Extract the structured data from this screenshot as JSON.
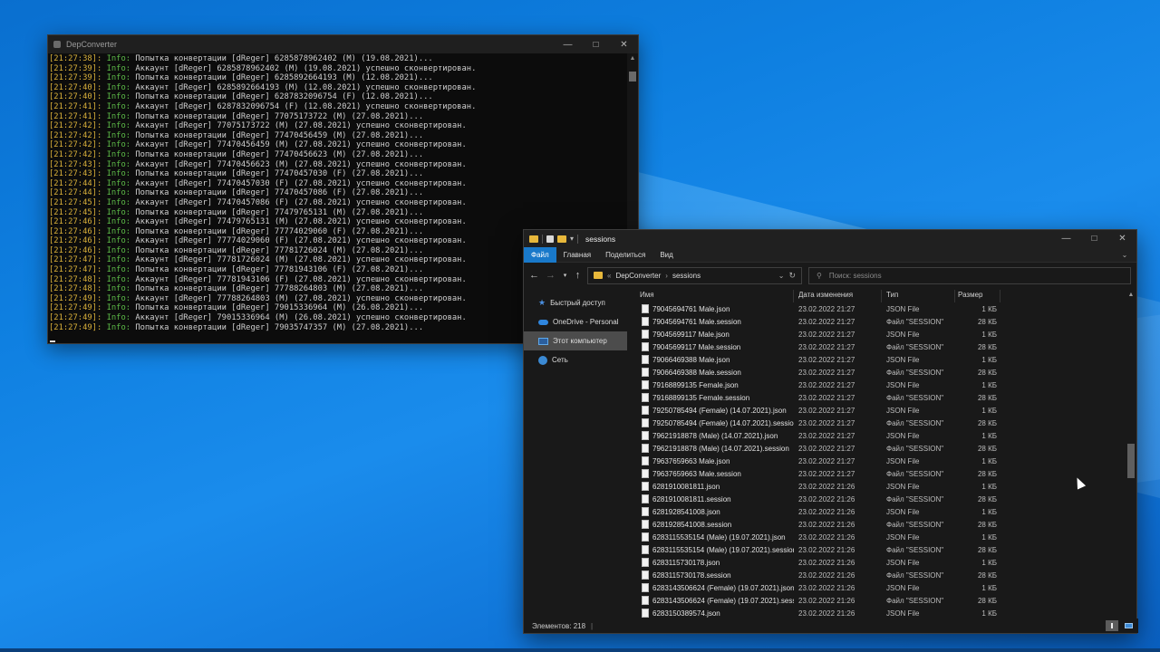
{
  "console": {
    "title": "DepConverter",
    "lines": [
      {
        "ts": "[21:27:38]:",
        "lvl": "Info:",
        "msg": "Попытка конвертации [dReger] 6285878962402 (M) (19.08.2021)..."
      },
      {
        "ts": "[21:27:39]:",
        "lvl": "Info:",
        "msg": "Аккаунт [dReger] 6285878962402 (M) (19.08.2021) успешно сконвертирован."
      },
      {
        "ts": "[21:27:39]:",
        "lvl": "Info:",
        "msg": "Попытка конвертации [dReger] 6285892664193 (M) (12.08.2021)..."
      },
      {
        "ts": "[21:27:40]:",
        "lvl": "Info:",
        "msg": "Аккаунт [dReger] 6285892664193 (M) (12.08.2021) успешно сконвертирован."
      },
      {
        "ts": "[21:27:40]:",
        "lvl": "Info:",
        "msg": "Попытка конвертации [dReger] 6287832096754 (F) (12.08.2021)..."
      },
      {
        "ts": "[21:27:41]:",
        "lvl": "Info:",
        "msg": "Аккаунт [dReger] 6287832096754 (F) (12.08.2021) успешно сконвертирован."
      },
      {
        "ts": "[21:27:41]:",
        "lvl": "Info:",
        "msg": "Попытка конвертации [dReger] 77075173722 (M) (27.08.2021)..."
      },
      {
        "ts": "[21:27:42]:",
        "lvl": "Info:",
        "msg": "Аккаунт [dReger] 77075173722 (M) (27.08.2021) успешно сконвертирован."
      },
      {
        "ts": "[21:27:42]:",
        "lvl": "Info:",
        "msg": "Попытка конвертации [dReger] 77470456459 (M) (27.08.2021)..."
      },
      {
        "ts": "[21:27:42]:",
        "lvl": "Info:",
        "msg": "Аккаунт [dReger] 77470456459 (M) (27.08.2021) успешно сконвертирован."
      },
      {
        "ts": "[21:27:42]:",
        "lvl": "Info:",
        "msg": "Попытка конвертации [dReger] 77470456623 (M) (27.08.2021)..."
      },
      {
        "ts": "[21:27:43]:",
        "lvl": "Info:",
        "msg": "Аккаунт [dReger] 77470456623 (M) (27.08.2021) успешно сконвертирован."
      },
      {
        "ts": "[21:27:43]:",
        "lvl": "Info:",
        "msg": "Попытка конвертации [dReger] 77470457030 (F) (27.08.2021)..."
      },
      {
        "ts": "[21:27:44]:",
        "lvl": "Info:",
        "msg": "Аккаунт [dReger] 77470457030 (F) (27.08.2021) успешно сконвертирован."
      },
      {
        "ts": "[21:27:44]:",
        "lvl": "Info:",
        "msg": "Попытка конвертации [dReger] 77470457086 (F) (27.08.2021)..."
      },
      {
        "ts": "[21:27:45]:",
        "lvl": "Info:",
        "msg": "Аккаунт [dReger] 77470457086 (F) (27.08.2021) успешно сконвертирован."
      },
      {
        "ts": "[21:27:45]:",
        "lvl": "Info:",
        "msg": "Попытка конвертации [dReger] 77479765131 (M) (27.08.2021)..."
      },
      {
        "ts": "[21:27:46]:",
        "lvl": "Info:",
        "msg": "Аккаунт [dReger] 77479765131 (M) (27.08.2021) успешно сконвертирован."
      },
      {
        "ts": "[21:27:46]:",
        "lvl": "Info:",
        "msg": "Попытка конвертации [dReger] 77774029060 (F) (27.08.2021)..."
      },
      {
        "ts": "[21:27:46]:",
        "lvl": "Info:",
        "msg": "Аккаунт [dReger] 77774029060 (F) (27.08.2021) успешно сконвертирован."
      },
      {
        "ts": "[21:27:46]:",
        "lvl": "Info:",
        "msg": "Попытка конвертации [dReger] 77781726024 (M) (27.08.2021)..."
      },
      {
        "ts": "[21:27:47]:",
        "lvl": "Info:",
        "msg": "Аккаунт [dReger] 77781726024 (M) (27.08.2021) успешно сконвертирован."
      },
      {
        "ts": "[21:27:47]:",
        "lvl": "Info:",
        "msg": "Попытка конвертации [dReger] 77781943106 (F) (27.08.2021)..."
      },
      {
        "ts": "[21:27:48]:",
        "lvl": "Info:",
        "msg": "Аккаунт [dReger] 77781943106 (F) (27.08.2021) успешно сконвертирован."
      },
      {
        "ts": "[21:27:48]:",
        "lvl": "Info:",
        "msg": "Попытка конвертации [dReger] 77788264803 (M) (27.08.2021)..."
      },
      {
        "ts": "[21:27:49]:",
        "lvl": "Info:",
        "msg": "Аккаунт [dReger] 77788264803 (M) (27.08.2021) успешно сконвертирован."
      },
      {
        "ts": "[21:27:49]:",
        "lvl": "Info:",
        "msg": "Попытка конвертации [dReger] 79015336964 (M) (26.08.2021)..."
      },
      {
        "ts": "[21:27:49]:",
        "lvl": "Info:",
        "msg": "Аккаунт [dReger] 79015336964 (M) (26.08.2021) успешно сконвертирован."
      },
      {
        "ts": "[21:27:49]:",
        "lvl": "Info:",
        "msg": "Попытка конвертации [dReger] 79035747357 (M) (27.08.2021)..."
      }
    ]
  },
  "explorer": {
    "title": "sessions",
    "ribbon_tabs": [
      "Файл",
      "Главная",
      "Поделиться",
      "Вид"
    ],
    "address": {
      "separator": "«",
      "parent": "DepConverter",
      "arrow": "›",
      "current": "sessions"
    },
    "search_placeholder": "Поиск: sessions",
    "nav_items": [
      {
        "label": "Быстрый доступ",
        "icon": "star-icon",
        "selected": false
      },
      {
        "label": "OneDrive - Personal",
        "icon": "cloud-icon",
        "selected": false
      },
      {
        "label": "Этот компьютер",
        "icon": "computer-icon",
        "selected": true
      },
      {
        "label": "Сеть",
        "icon": "network-icon",
        "selected": false
      }
    ],
    "columns": {
      "name": "Имя",
      "date": "Дата изменения",
      "type": "Тип",
      "size": "Размер"
    },
    "files": [
      {
        "name": "79045694761 Male.json",
        "date": "23.02.2022 21:27",
        "type": "JSON File",
        "size": "1 КБ"
      },
      {
        "name": "79045694761 Male.session",
        "date": "23.02.2022 21:27",
        "type": "Файл \"SESSION\"",
        "size": "28 КБ"
      },
      {
        "name": "79045699117 Male.json",
        "date": "23.02.2022 21:27",
        "type": "JSON File",
        "size": "1 КБ"
      },
      {
        "name": "79045699117 Male.session",
        "date": "23.02.2022 21:27",
        "type": "Файл \"SESSION\"",
        "size": "28 КБ"
      },
      {
        "name": "79066469388 Male.json",
        "date": "23.02.2022 21:27",
        "type": "JSON File",
        "size": "1 КБ"
      },
      {
        "name": "79066469388 Male.session",
        "date": "23.02.2022 21:27",
        "type": "Файл \"SESSION\"",
        "size": "28 КБ"
      },
      {
        "name": "79168899135 Female.json",
        "date": "23.02.2022 21:27",
        "type": "JSON File",
        "size": "1 КБ"
      },
      {
        "name": "79168899135 Female.session",
        "date": "23.02.2022 21:27",
        "type": "Файл \"SESSION\"",
        "size": "28 КБ"
      },
      {
        "name": "79250785494 (Female) (14.07.2021).json",
        "date": "23.02.2022 21:27",
        "type": "JSON File",
        "size": "1 КБ"
      },
      {
        "name": "79250785494 (Female) (14.07.2021).session",
        "date": "23.02.2022 21:27",
        "type": "Файл \"SESSION\"",
        "size": "28 КБ"
      },
      {
        "name": "79621918878 (Male) (14.07.2021).json",
        "date": "23.02.2022 21:27",
        "type": "JSON File",
        "size": "1 КБ"
      },
      {
        "name": "79621918878 (Male) (14.07.2021).session",
        "date": "23.02.2022 21:27",
        "type": "Файл \"SESSION\"",
        "size": "28 КБ"
      },
      {
        "name": "79637659663 Male.json",
        "date": "23.02.2022 21:27",
        "type": "JSON File",
        "size": "1 КБ"
      },
      {
        "name": "79637659663 Male.session",
        "date": "23.02.2022 21:27",
        "type": "Файл \"SESSION\"",
        "size": "28 КБ"
      },
      {
        "name": "6281910081811.json",
        "date": "23.02.2022 21:26",
        "type": "JSON File",
        "size": "1 КБ"
      },
      {
        "name": "6281910081811.session",
        "date": "23.02.2022 21:26",
        "type": "Файл \"SESSION\"",
        "size": "28 КБ"
      },
      {
        "name": "6281928541008.json",
        "date": "23.02.2022 21:26",
        "type": "JSON File",
        "size": "1 КБ"
      },
      {
        "name": "6281928541008.session",
        "date": "23.02.2022 21:26",
        "type": "Файл \"SESSION\"",
        "size": "28 КБ"
      },
      {
        "name": "6283115535154 (Male) (19.07.2021).json",
        "date": "23.02.2022 21:26",
        "type": "JSON File",
        "size": "1 КБ"
      },
      {
        "name": "6283115535154 (Male) (19.07.2021).session",
        "date": "23.02.2022 21:26",
        "type": "Файл \"SESSION\"",
        "size": "28 КБ"
      },
      {
        "name": "6283115730178.json",
        "date": "23.02.2022 21:26",
        "type": "JSON File",
        "size": "1 КБ"
      },
      {
        "name": "6283115730178.session",
        "date": "23.02.2022 21:26",
        "type": "Файл \"SESSION\"",
        "size": "28 КБ"
      },
      {
        "name": "6283143506624 (Female) (19.07.2021).json",
        "date": "23.02.2022 21:26",
        "type": "JSON File",
        "size": "1 КБ"
      },
      {
        "name": "6283143506624 (Female) (19.07.2021).sess...",
        "date": "23.02.2022 21:26",
        "type": "Файл \"SESSION\"",
        "size": "28 КБ"
      },
      {
        "name": "6283150389574.json",
        "date": "23.02.2022 21:26",
        "type": "JSON File",
        "size": "1 КБ"
      }
    ],
    "status_text": "Элементов: 218"
  }
}
